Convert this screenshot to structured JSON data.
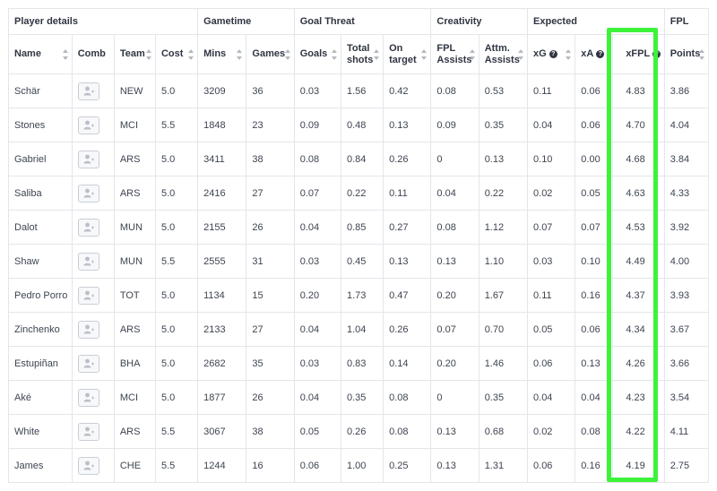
{
  "groups": [
    {
      "label": "Player details"
    },
    {
      "label": "Gametime"
    },
    {
      "label": "Goal Threat"
    },
    {
      "label": "Creativity"
    },
    {
      "label": "Expected"
    },
    {
      "label": "FPL"
    }
  ],
  "columns": [
    {
      "label": "Name"
    },
    {
      "label": "Comb"
    },
    {
      "label": "Team"
    },
    {
      "label": "Cost"
    },
    {
      "label": "Mins"
    },
    {
      "label": "Games"
    },
    {
      "label": "Goals"
    },
    {
      "label": "Total shots"
    },
    {
      "label": "On target"
    },
    {
      "label": "FPL Assists"
    },
    {
      "label": "Attm. Assists"
    },
    {
      "label": "xG"
    },
    {
      "label": "xA"
    },
    {
      "label": "xFPL"
    },
    {
      "label": "Points"
    }
  ],
  "help_icon": "?",
  "comb_icon": "add-user-icon",
  "highlight_color": "#3cf33a",
  "rows": [
    {
      "name": "Schär",
      "team": "NEW",
      "cost": "5.0",
      "mins": "3209",
      "games": "36",
      "goals": "0.03",
      "shots": "1.56",
      "on_target": "0.42",
      "fpl_assists": "0.08",
      "attm_assists": "0.53",
      "xg": "0.11",
      "xa": "0.06",
      "xfpl": "4.83",
      "points": "3.86"
    },
    {
      "name": "Stones",
      "team": "MCI",
      "cost": "5.5",
      "mins": "1848",
      "games": "23",
      "goals": "0.09",
      "shots": "0.48",
      "on_target": "0.13",
      "fpl_assists": "0.09",
      "attm_assists": "0.35",
      "xg": "0.04",
      "xa": "0.06",
      "xfpl": "4.70",
      "points": "4.04"
    },
    {
      "name": "Gabriel",
      "team": "ARS",
      "cost": "5.0",
      "mins": "3411",
      "games": "38",
      "goals": "0.08",
      "shots": "0.84",
      "on_target": "0.26",
      "fpl_assists": "0",
      "attm_assists": "0.13",
      "xg": "0.10",
      "xa": "0.00",
      "xfpl": "4.68",
      "points": "3.84"
    },
    {
      "name": "Saliba",
      "team": "ARS",
      "cost": "5.0",
      "mins": "2416",
      "games": "27",
      "goals": "0.07",
      "shots": "0.22",
      "on_target": "0.11",
      "fpl_assists": "0.04",
      "attm_assists": "0.22",
      "xg": "0.02",
      "xa": "0.05",
      "xfpl": "4.63",
      "points": "4.33"
    },
    {
      "name": "Dalot",
      "team": "MUN",
      "cost": "5.0",
      "mins": "2155",
      "games": "26",
      "goals": "0.04",
      "shots": "0.85",
      "on_target": "0.27",
      "fpl_assists": "0.08",
      "attm_assists": "1.12",
      "xg": "0.07",
      "xa": "0.07",
      "xfpl": "4.53",
      "points": "3.92"
    },
    {
      "name": "Shaw",
      "team": "MUN",
      "cost": "5.5",
      "mins": "2555",
      "games": "31",
      "goals": "0.03",
      "shots": "0.45",
      "on_target": "0.13",
      "fpl_assists": "0.13",
      "attm_assists": "1.10",
      "xg": "0.03",
      "xa": "0.10",
      "xfpl": "4.49",
      "points": "4.00"
    },
    {
      "name": "Pedro Porro",
      "team": "TOT",
      "cost": "5.0",
      "mins": "1134",
      "games": "15",
      "goals": "0.20",
      "shots": "1.73",
      "on_target": "0.47",
      "fpl_assists": "0.20",
      "attm_assists": "1.67",
      "xg": "0.11",
      "xa": "0.16",
      "xfpl": "4.37",
      "points": "3.93"
    },
    {
      "name": "Zinchenko",
      "team": "ARS",
      "cost": "5.0",
      "mins": "2133",
      "games": "27",
      "goals": "0.04",
      "shots": "1.04",
      "on_target": "0.26",
      "fpl_assists": "0.07",
      "attm_assists": "0.70",
      "xg": "0.05",
      "xa": "0.06",
      "xfpl": "4.34",
      "points": "3.67"
    },
    {
      "name": "Estupiñan",
      "team": "BHA",
      "cost": "5.0",
      "mins": "2682",
      "games": "35",
      "goals": "0.03",
      "shots": "0.83",
      "on_target": "0.14",
      "fpl_assists": "0.20",
      "attm_assists": "1.46",
      "xg": "0.06",
      "xa": "0.13",
      "xfpl": "4.26",
      "points": "3.66"
    },
    {
      "name": "Aké",
      "team": "MCI",
      "cost": "5.0",
      "mins": "1877",
      "games": "26",
      "goals": "0.04",
      "shots": "0.35",
      "on_target": "0.08",
      "fpl_assists": "0",
      "attm_assists": "0.35",
      "xg": "0.04",
      "xa": "0.04",
      "xfpl": "4.23",
      "points": "3.54"
    },
    {
      "name": "White",
      "team": "ARS",
      "cost": "5.5",
      "mins": "3067",
      "games": "38",
      "goals": "0.05",
      "shots": "0.26",
      "on_target": "0.08",
      "fpl_assists": "0.13",
      "attm_assists": "0.68",
      "xg": "0.02",
      "xa": "0.08",
      "xfpl": "4.22",
      "points": "4.11"
    },
    {
      "name": "James",
      "team": "CHE",
      "cost": "5.5",
      "mins": "1244",
      "games": "16",
      "goals": "0.06",
      "shots": "1.00",
      "on_target": "0.25",
      "fpl_assists": "0.13",
      "attm_assists": "1.31",
      "xg": "0.06",
      "xa": "0.16",
      "xfpl": "4.19",
      "points": "2.75"
    }
  ]
}
